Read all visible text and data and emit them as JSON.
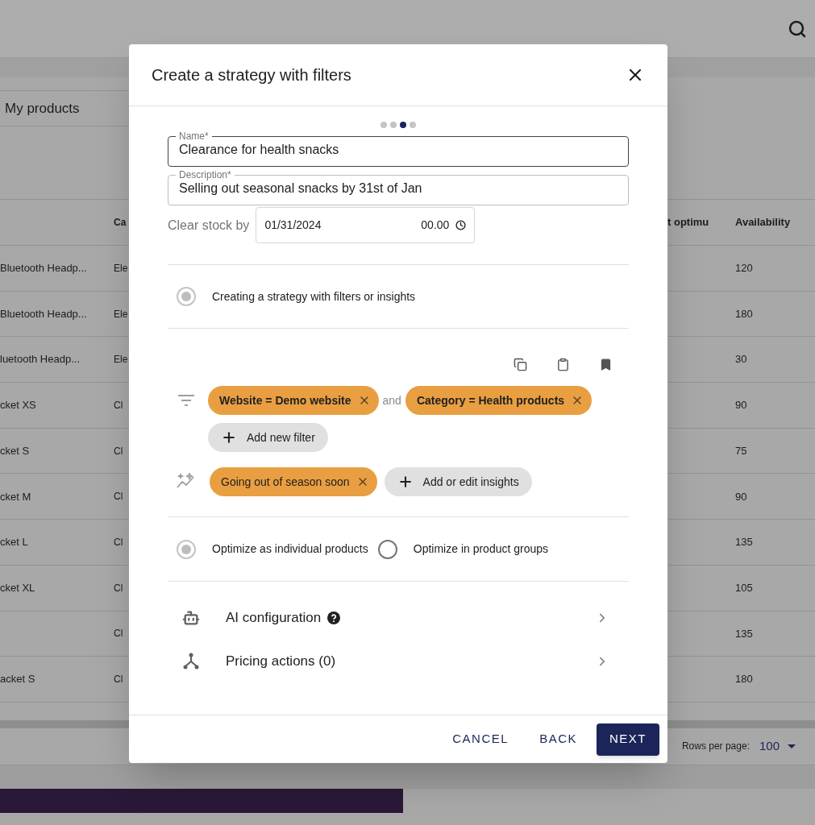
{
  "app": {
    "tab": "My products"
  },
  "table": {
    "columns": [
      "Ca",
      "t optimu",
      "Availability"
    ],
    "rows": [
      {
        "name": "Bluetooth Headp...",
        "category": "Ele",
        "availability": "120"
      },
      {
        "name": "Bluetooth Headp...",
        "category": "Ele",
        "availability": "180"
      },
      {
        "name": "luetooth Headp...",
        "category": "Ele",
        "availability": "30"
      },
      {
        "name": "cket XS",
        "category": "Cl",
        "availability": "90"
      },
      {
        "name": "cket S",
        "category": "Cl",
        "availability": "75"
      },
      {
        "name": "cket M",
        "category": "Cl",
        "availability": "90"
      },
      {
        "name": "cket L",
        "category": "Cl",
        "availability": "135"
      },
      {
        "name": "cket XL",
        "category": "Cl",
        "availability": "105"
      },
      {
        "name": "",
        "category": "Cl",
        "availability": "135"
      },
      {
        "name": "acket S",
        "category": "Cl",
        "availability": "180"
      }
    ]
  },
  "pagination": {
    "label": "Rows per page:",
    "value": "100"
  },
  "dialog": {
    "title": "Create a strategy with filters",
    "steps": [
      {
        "selected": false
      },
      {
        "selected": false
      },
      {
        "selected": true
      },
      {
        "selected": false
      }
    ],
    "fields": [
      {
        "label": "Name*",
        "value": "Clearance for health snacks",
        "focused": true
      },
      {
        "label": "Description*",
        "value": "Selling out seasonal snacks by 31st of Jan",
        "focused": false
      }
    ],
    "clear_stock": {
      "label": "Clear stock by",
      "date": "01/31/2024",
      "time": "00.00"
    },
    "strategy_option": {
      "label": "Creating a strategy with filters or insights",
      "selected": true,
      "disabled": true
    },
    "filters": [
      {
        "label": "Website = Demo website"
      },
      {
        "label": "Category = Health products"
      }
    ],
    "connector": "and",
    "add_filter": "Add new filter",
    "insights": [
      {
        "label": "Going out of season soon"
      }
    ],
    "add_insights": "Add or edit insights",
    "optimize_options": [
      {
        "label": "Optimize as individual products",
        "selected": true,
        "disabled": true
      },
      {
        "label": "Optimize in product groups",
        "selected": false,
        "disabled": false
      }
    ],
    "sections": [
      {
        "label": "AI configuration",
        "kind": "ai",
        "help": true
      },
      {
        "label": "Pricing actions (0)",
        "kind": "pricing",
        "help": false
      }
    ],
    "buttons": [
      {
        "label": "CANCEL",
        "kind": "text"
      },
      {
        "label": "BACK",
        "kind": "text"
      },
      {
        "label": "NEXT",
        "kind": "primary"
      }
    ]
  }
}
